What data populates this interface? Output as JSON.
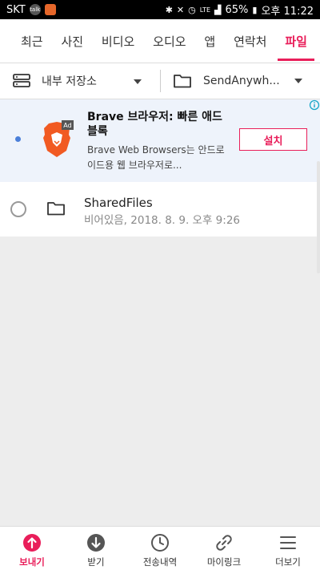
{
  "status_bar": {
    "carrier": "SKT",
    "battery": "65%",
    "time": "오후 11:22",
    "network": "LTE"
  },
  "tabs": [
    {
      "label": "최근"
    },
    {
      "label": "사진"
    },
    {
      "label": "비디오"
    },
    {
      "label": "오디오"
    },
    {
      "label": "앱"
    },
    {
      "label": "연락처"
    },
    {
      "label": "파일",
      "active": true
    }
  ],
  "storage": {
    "location": "내부 저장소",
    "folder": "SendAnywh..."
  },
  "ad": {
    "title": "Brave 브라우저: 빠른 애드블록",
    "description": "Brave Web Browsers는 안드로이드용 웹 브라우저로...",
    "badge": "Ad",
    "install_label": "설치"
  },
  "files": [
    {
      "name": "SharedFiles",
      "meta": "비어있음, 2018. 8. 9. 오후 9:26"
    }
  ],
  "bottom_nav": [
    {
      "label": "보내기",
      "icon": "upload-icon",
      "active": true
    },
    {
      "label": "받기",
      "icon": "download-icon"
    },
    {
      "label": "전송내역",
      "icon": "clock-icon"
    },
    {
      "label": "마이링크",
      "icon": "link-icon"
    },
    {
      "label": "더보기",
      "icon": "menu-icon"
    }
  ],
  "colors": {
    "accent": "#e91e5a",
    "ad_background": "#eef3fb",
    "page_background": "#ededed"
  }
}
